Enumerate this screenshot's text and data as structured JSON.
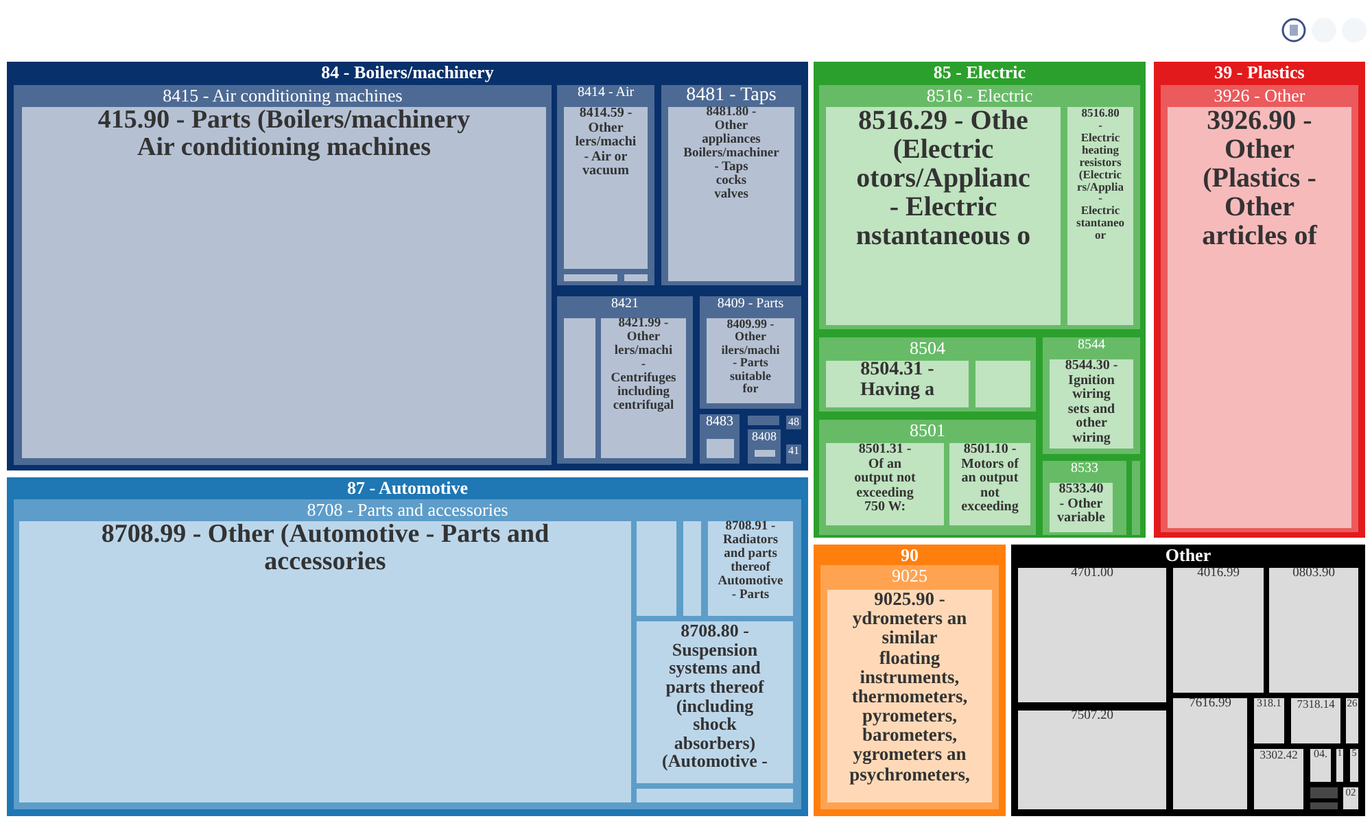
{
  "chart": {
    "kind": "treemap",
    "tiles": [
      {
        "kind": "group",
        "label": "84 - Boilers/machinery",
        "color": "#08306b",
        "children": [
          {
            "kind": "group",
            "label": "8415 - Air conditioning machines",
            "children": [
              {
                "kind": "leaf",
                "label": "415.90 - Parts (Boilers/machinery\nAir conditioning machines"
              }
            ]
          },
          {
            "kind": "group",
            "label": "8414 - Air",
            "children": [
              {
                "kind": "leaf",
                "label": "8414.59 -\nOther\nlers/machi\n- Air or\nvacuum"
              },
              {
                "kind": "blank"
              },
              {
                "kind": "blank"
              }
            ]
          },
          {
            "kind": "group",
            "label": "8481 - Taps",
            "children": [
              {
                "kind": "leaf",
                "label": "8481.80 -\nOther\nappliances\nBoilers/machiner\n- Taps\ncocks\nvalves"
              }
            ]
          },
          {
            "kind": "group",
            "label": "8421",
            "children": [
              {
                "kind": "blank"
              },
              {
                "kind": "leaf",
                "label": "8421.99 -\nOther\nlers/machi\n-\nCentrifuges\nincluding\ncentrifugal"
              }
            ]
          },
          {
            "kind": "group",
            "label": "8409 - Parts",
            "children": [
              {
                "kind": "leaf",
                "label": "8409.99 -\nOther\nilers/machi\n- Parts\nsuitable\nfor"
              }
            ]
          },
          {
            "kind": "group",
            "label": "8483",
            "children": [
              {
                "kind": "blank"
              }
            ]
          },
          {
            "kind": "group",
            "label": "8408",
            "children": [
              {
                "kind": "blank"
              }
            ]
          },
          {
            "kind": "blank"
          },
          {
            "kind": "group",
            "label": "48"
          },
          {
            "kind": "group",
            "label": "41"
          }
        ]
      },
      {
        "kind": "group",
        "label": "87 - Automotive",
        "color": "#1f77b4",
        "children": [
          {
            "kind": "group",
            "label": "8708 - Parts and accessories",
            "children": [
              {
                "kind": "leaf",
                "label": "8708.99 - Other (Automotive - Parts and\naccessories"
              },
              {
                "kind": "blank"
              },
              {
                "kind": "blank"
              },
              {
                "kind": "leaf",
                "label": "8708.91 -\nRadiators\nand parts\nthereof\nAutomotive\n- Parts"
              },
              {
                "kind": "leaf",
                "label": "8708.80 -\nSuspension\nsystems and\nparts thereof\n(including\nshock\nabsorbers)\n(Automotive -"
              },
              {
                "kind": "blank"
              }
            ]
          }
        ]
      },
      {
        "kind": "group",
        "label": "85 - Electric",
        "color": "#2ca02c",
        "children": [
          {
            "kind": "group",
            "label": "8516 - Electric",
            "children": [
              {
                "kind": "leaf",
                "label": "8516.29 - Othe\n(Electric\notors/Applianc\n- Electric\nnstantaneous o"
              },
              {
                "kind": "leaf",
                "label": "8516.80\n-\nElectric\nheating\nresistors\n(Electric\nrs/Applia\n-\nElectric\nstantaneo\nor"
              }
            ]
          },
          {
            "kind": "group",
            "label": "8504",
            "children": [
              {
                "kind": "leaf",
                "label": "8504.31 -\nHaving a"
              },
              {
                "kind": "blank"
              }
            ]
          },
          {
            "kind": "group",
            "label": "8501",
            "children": [
              {
                "kind": "leaf",
                "label": "8501.31 -\nOf an\noutput not\nexceeding\n750 W:"
              },
              {
                "kind": "leaf",
                "label": "8501.10 -\nMotors of\nan output\nnot\nexceeding"
              }
            ]
          },
          {
            "kind": "group",
            "label": "8544",
            "children": [
              {
                "kind": "leaf",
                "label": "8544.30 -\nIgnition\nwiring\nsets and\nother\nwiring"
              }
            ]
          },
          {
            "kind": "group",
            "label": "8533",
            "children": [
              {
                "kind": "leaf",
                "label": "8533.40\n- Other\nvariable"
              }
            ]
          },
          {
            "kind": "blank"
          }
        ]
      },
      {
        "kind": "group",
        "label": "39 - Plastics",
        "color": "#e31a1c",
        "children": [
          {
            "kind": "group",
            "label": "3926 - Other",
            "children": [
              {
                "kind": "leaf",
                "label": "3926.90 -\nOther\n(Plastics -\nOther\narticles of"
              }
            ]
          }
        ]
      },
      {
        "kind": "group",
        "label": "90",
        "color": "#ff7f0e",
        "children": [
          {
            "kind": "group",
            "label": "9025",
            "children": [
              {
                "kind": "leaf",
                "label": "9025.90 -\nydrometers an\nsimilar\nfloating\ninstruments,\nthermometers,\npyrometers,\nbarometers,\nygrometers an\npsychrometers,"
              }
            ]
          }
        ]
      },
      {
        "kind": "group",
        "label": "Other",
        "color": "#000000",
        "children": [
          {
            "kind": "leaf",
            "label": "4701.00"
          },
          {
            "kind": "leaf",
            "label": "4016.99"
          },
          {
            "kind": "leaf",
            "label": "0803.90"
          },
          {
            "kind": "leaf",
            "label": "7507.20"
          },
          {
            "kind": "leaf",
            "label": "7616.99"
          },
          {
            "kind": "leaf",
            "label": "318.1"
          },
          {
            "kind": "leaf",
            "label": "7318.14"
          },
          {
            "kind": "leaf",
            "label": "26"
          },
          {
            "kind": "leaf",
            "label": "3302.42"
          },
          {
            "kind": "leaf",
            "label": "04."
          },
          {
            "kind": "leaf",
            "label": "1"
          },
          {
            "kind": "leaf",
            "label": "5"
          },
          {
            "kind": "blank"
          },
          {
            "kind": "blank"
          },
          {
            "kind": "leaf",
            "label": "02"
          }
        ]
      }
    ]
  }
}
